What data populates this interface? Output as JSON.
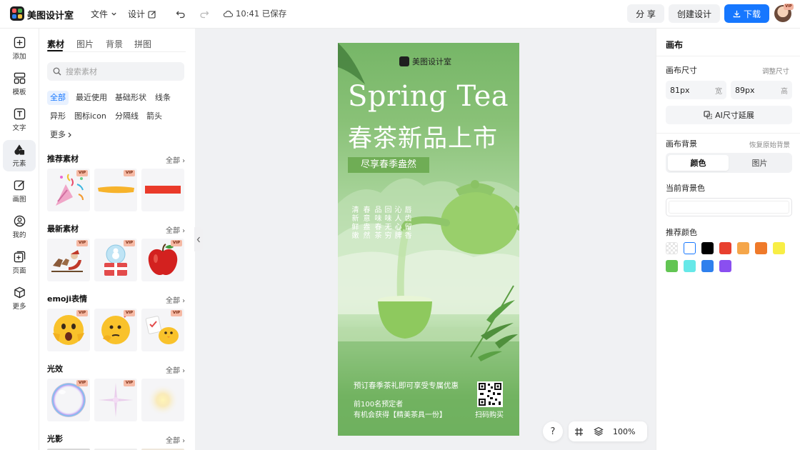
{
  "topbar": {
    "app_name": "美图设计室",
    "menu_file": "文件",
    "menu_design": "设计",
    "saved_status": "10:41 已保存",
    "share_label": "分 享",
    "create_label": "创建设计",
    "download_label": "下载",
    "avatar_badge": "VIP",
    "logo_colors": [
      "#ff5b5b",
      "#4caf50",
      "#2f80ed",
      "#f5c542"
    ]
  },
  "leftnav": {
    "items": [
      {
        "label": "添加",
        "icon": "plus-square-icon"
      },
      {
        "label": "模板",
        "icon": "template-grid-icon"
      },
      {
        "label": "文字",
        "icon": "text-icon"
      },
      {
        "label": "元素",
        "icon": "shapes-icon",
        "active": true
      },
      {
        "label": "画图",
        "icon": "pen-icon"
      },
      {
        "label": "我的",
        "icon": "user-icon"
      },
      {
        "label": "页面",
        "icon": "page-add-icon"
      },
      {
        "label": "更多",
        "icon": "cube-icon"
      }
    ]
  },
  "panel": {
    "tabs": [
      {
        "label": "素材",
        "active": true
      },
      {
        "label": "图片"
      },
      {
        "label": "背景"
      },
      {
        "label": "拼图"
      }
    ],
    "search_placeholder": "搜索素材",
    "categories": [
      {
        "label": "全部",
        "active": true
      },
      {
        "label": "最近使用"
      },
      {
        "label": "基础形状"
      },
      {
        "label": "线条"
      },
      {
        "label": "异形"
      },
      {
        "label": "图标icon"
      },
      {
        "label": "分隔线"
      },
      {
        "label": "箭头"
      },
      {
        "label": "更多"
      }
    ],
    "see_all": "全部",
    "vip_badge": "VIP",
    "sections": [
      {
        "title": "推荐素材",
        "items": [
          "confetti-popper",
          "yellow-brush-stroke",
          "red-rectangle"
        ],
        "vip": [
          true,
          true,
          false
        ]
      },
      {
        "title": "最新素材",
        "items": [
          "santa-sleigh",
          "snow-globe-gift",
          "red-apple"
        ],
        "vip": [
          true,
          true,
          true
        ]
      },
      {
        "title": "emoji表情",
        "items": [
          "shocked-emoji",
          "thinking-emoji",
          "checklist-chick"
        ],
        "vip": [
          true,
          true,
          true
        ]
      },
      {
        "title": "光效",
        "items": [
          "soap-bubble",
          "pink-sparkle",
          "yellow-glow"
        ],
        "vip": [
          true,
          true,
          false
        ]
      },
      {
        "title": "光影",
        "items": [],
        "vip": []
      }
    ]
  },
  "poster": {
    "brand": "美图设计室",
    "title_en": "Spring Tea",
    "title_cn": "春茶新品上市",
    "tag": "尽享春季盎然",
    "vertical_lines": [
      "清新鲜嫩",
      "春意盎然",
      "品味春茶",
      "回味无穷",
      "沁人心脾",
      "唇齿留香"
    ],
    "promo_1": "预订春季茶礼即可享受专属优惠",
    "promo_2": "前100名预定者",
    "promo_3": "有机会获得【精美茶具一份】",
    "qr_label": "扫码购买"
  },
  "floatbar": {
    "help": "?",
    "zoom": "100%"
  },
  "right": {
    "title": "画布",
    "size_label": "画布尺寸",
    "size_adjust": "调整尺寸",
    "width_value": "81px",
    "width_unit": "宽",
    "height_value": "89px",
    "height_unit": "高",
    "ai_extend": "AI尺寸延展",
    "bg_label": "画布背景",
    "bg_reset": "恢复原始背景",
    "seg_color": "颜色",
    "seg_image": "图片",
    "current_bg": "当前背景色",
    "recommend": "推荐颜色",
    "swatches": [
      "transparent",
      "#ffffff",
      "#000000",
      "#e8402f",
      "#f5a64a",
      "#ef7a2a",
      "#f8ee45",
      "#62c553",
      "#66e8e8",
      "#2f80ed",
      "#8a4ff0"
    ]
  }
}
